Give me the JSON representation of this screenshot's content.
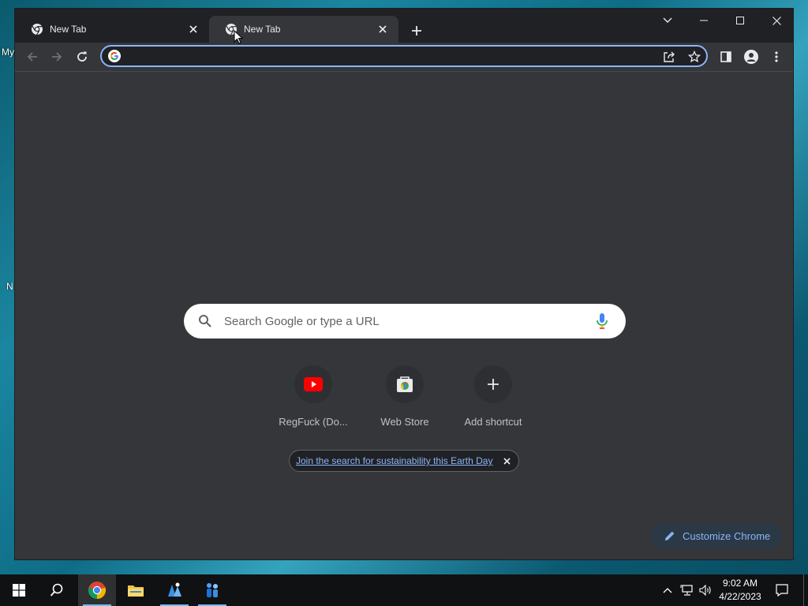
{
  "desktop": {
    "fragments": [
      "My",
      "N"
    ]
  },
  "browser": {
    "tabs": [
      {
        "title": "New Tab",
        "active": false,
        "icon": "chrome-icon"
      },
      {
        "title": "New Tab",
        "active": true,
        "icon": "chrome-icon"
      }
    ],
    "omnibox": {
      "value": "",
      "placeholder": ""
    },
    "ntp": {
      "search_placeholder": "Search Google or type a URL",
      "shortcuts": [
        {
          "label": "RegFuck (Do...",
          "icon": "youtube-icon"
        },
        {
          "label": "Web Store",
          "icon": "web-store-icon"
        },
        {
          "label": "Add shortcut",
          "icon": "plus-icon"
        }
      ],
      "promo_link": "Join the search for sustainability this Earth Day",
      "customize_label": "Customize Chrome"
    },
    "colors": {
      "frame": "#202124",
      "toolbar": "#35363a",
      "accent": "#8ab4f8"
    }
  },
  "taskbar": {
    "apps": [
      "start-icon",
      "search-icon",
      "chrome-icon",
      "file-explorer-icon",
      "app-icon-blue",
      "people-icon"
    ],
    "clock": {
      "time": "9:02 AM",
      "date": "4/22/2023"
    }
  }
}
